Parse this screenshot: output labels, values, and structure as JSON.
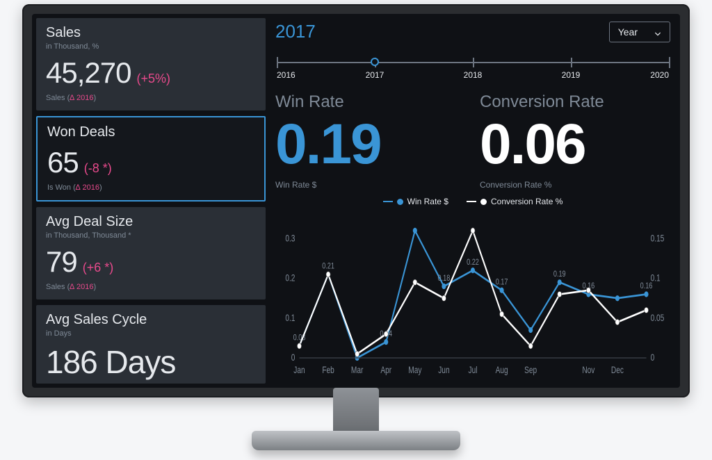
{
  "controls": {
    "period_label": "Year",
    "selected_year": "2017"
  },
  "timeline": {
    "years": [
      "2016",
      "2017",
      "2018",
      "2019",
      "2020"
    ],
    "selected_index": 1
  },
  "cards": {
    "sales": {
      "title": "Sales",
      "subtitle": "in Thousand, %",
      "value": "45,270",
      "delta": "(+5%)",
      "footer_prefix": "Sales (",
      "footer_delta": "∆ 2016",
      "footer_suffix": ")"
    },
    "won_deals": {
      "title": "Won Deals",
      "subtitle": "",
      "value": "65",
      "delta": "(-8 *)",
      "footer_prefix": "Is Won (",
      "footer_delta": "∆ 2016",
      "footer_suffix": ")"
    },
    "avg_deal_size": {
      "title": "Avg Deal Size",
      "subtitle": "in Thousand, Thousand *",
      "value": "79",
      "delta": "(+6 *)",
      "footer_prefix": "Sales (",
      "footer_delta": "∆ 2016",
      "footer_suffix": ")"
    },
    "avg_sales_cycle": {
      "title": "Avg Sales Cycle",
      "subtitle": "in Days",
      "value": "186 Days",
      "delta": "",
      "footer_prefix": "",
      "footer_delta": "",
      "footer_suffix": ""
    }
  },
  "kpis": {
    "win_rate": {
      "title": "Win Rate",
      "value": "0.19",
      "sub": "Win Rate $"
    },
    "conversion": {
      "title": "Conversion Rate",
      "value": "0.06",
      "sub": "Conversion Rate %"
    }
  },
  "legend": {
    "a": "Win Rate $",
    "b": "Conversion Rate %"
  },
  "chart_data": {
    "type": "line",
    "title": "",
    "xlabel": "",
    "ylabel_left": "",
    "ylabel_right": "",
    "categories": [
      "Jan",
      "Feb",
      "Mar",
      "Apr",
      "May",
      "Jun",
      "Jul",
      "Aug",
      "Sep",
      "Nov",
      "Dec"
    ],
    "y_left_ticks": [
      0,
      0.1,
      0.2,
      0.3
    ],
    "y_right_ticks": [
      0,
      0.05,
      0.1,
      0.15
    ],
    "ylim_left": [
      0,
      0.35
    ],
    "ylim_right": [
      0,
      0.175
    ],
    "series": [
      {
        "name": "Win Rate $",
        "axis": "left",
        "color": "#3a95d6",
        "values": [
          0.03,
          0.21,
          0.0,
          0.04,
          0.32,
          0.18,
          0.22,
          0.17,
          0.07,
          0.19,
          0.16,
          0.15,
          0.16
        ],
        "value_labels": [
          "0.03",
          "0.21",
          "",
          "0.04",
          "",
          "0.18",
          "0.22",
          "0.17",
          "",
          "0.19",
          "0.16",
          "",
          "0.16"
        ]
      },
      {
        "name": "Conversion Rate %",
        "axis": "right",
        "color": "#ffffff",
        "values": [
          0.015,
          0.105,
          0.005,
          0.03,
          0.095,
          0.075,
          0.16,
          0.055,
          0.015,
          0.08,
          0.085,
          0.045,
          0.06
        ],
        "value_labels": [
          "",
          "",
          "",
          "",
          "",
          "",
          "",
          "",
          "",
          "",
          "",
          "",
          ""
        ]
      }
    ],
    "note_months_axis_shows": [
      "Jan",
      "Feb",
      "Mar",
      "Apr",
      "May",
      "Jun",
      "Jul",
      "Aug",
      "Sep",
      "Nov",
      "Dec"
    ]
  }
}
